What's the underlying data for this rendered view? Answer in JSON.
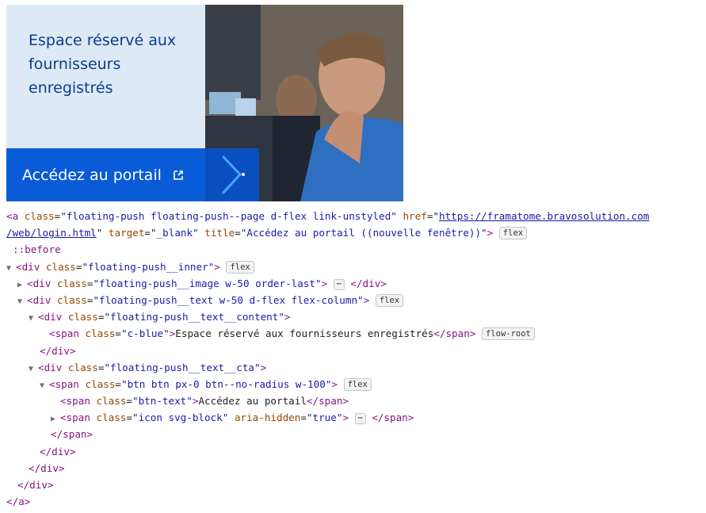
{
  "push": {
    "title": "Espace réservé aux fournisseurs enregistrés",
    "cta_label": "Accédez au portail",
    "colors": {
      "panel_bg": "#dde9f5",
      "title": "#0b3d91",
      "cta_bg": "#0a5bd7"
    }
  },
  "devtools": {
    "l1_open": "<a ",
    "l1_attr1": "class",
    "l1_val1": "\"floating-push floating-push--page d-flex link-unstyled\"",
    "l1_attr2": "href",
    "l1_href_a": "https://framatome.bravosolution.com",
    "l1_href_b": "/web/login.html",
    "l1_attr3": "target",
    "l1_val3": "\"_blank\"",
    "l1_attr4": "title",
    "l1_val4": "\"Accédez au portail ((nouvelle fenêtre))\"",
    "badge_flex": "flex",
    "badge_flow_root": "flow-root",
    "before": "::before",
    "inner_class": "\"floating-push__inner\"",
    "image_class": "\"floating-push__image w-50 order-last\"",
    "text_class": "\"floating-push__text w-50 d-flex flex-column\"",
    "content_class": "\"floating-push__text__content\"",
    "span_class": "\"c-blue\"",
    "span_text": "Espace réservé aux fournisseurs enregistrés",
    "cta_class": "\"floating-push__text__cta\"",
    "btn_class": "\"btn btn px-0 btn--no-radius w-100\"",
    "btntext_class": "\"btn-text\"",
    "btntext_text": "Accédez au portail",
    "icon_class": "\"icon svg-block\"",
    "aria_attr": "aria-hidden",
    "aria_val": "\"true\"",
    "ellipsis": "⋯"
  }
}
